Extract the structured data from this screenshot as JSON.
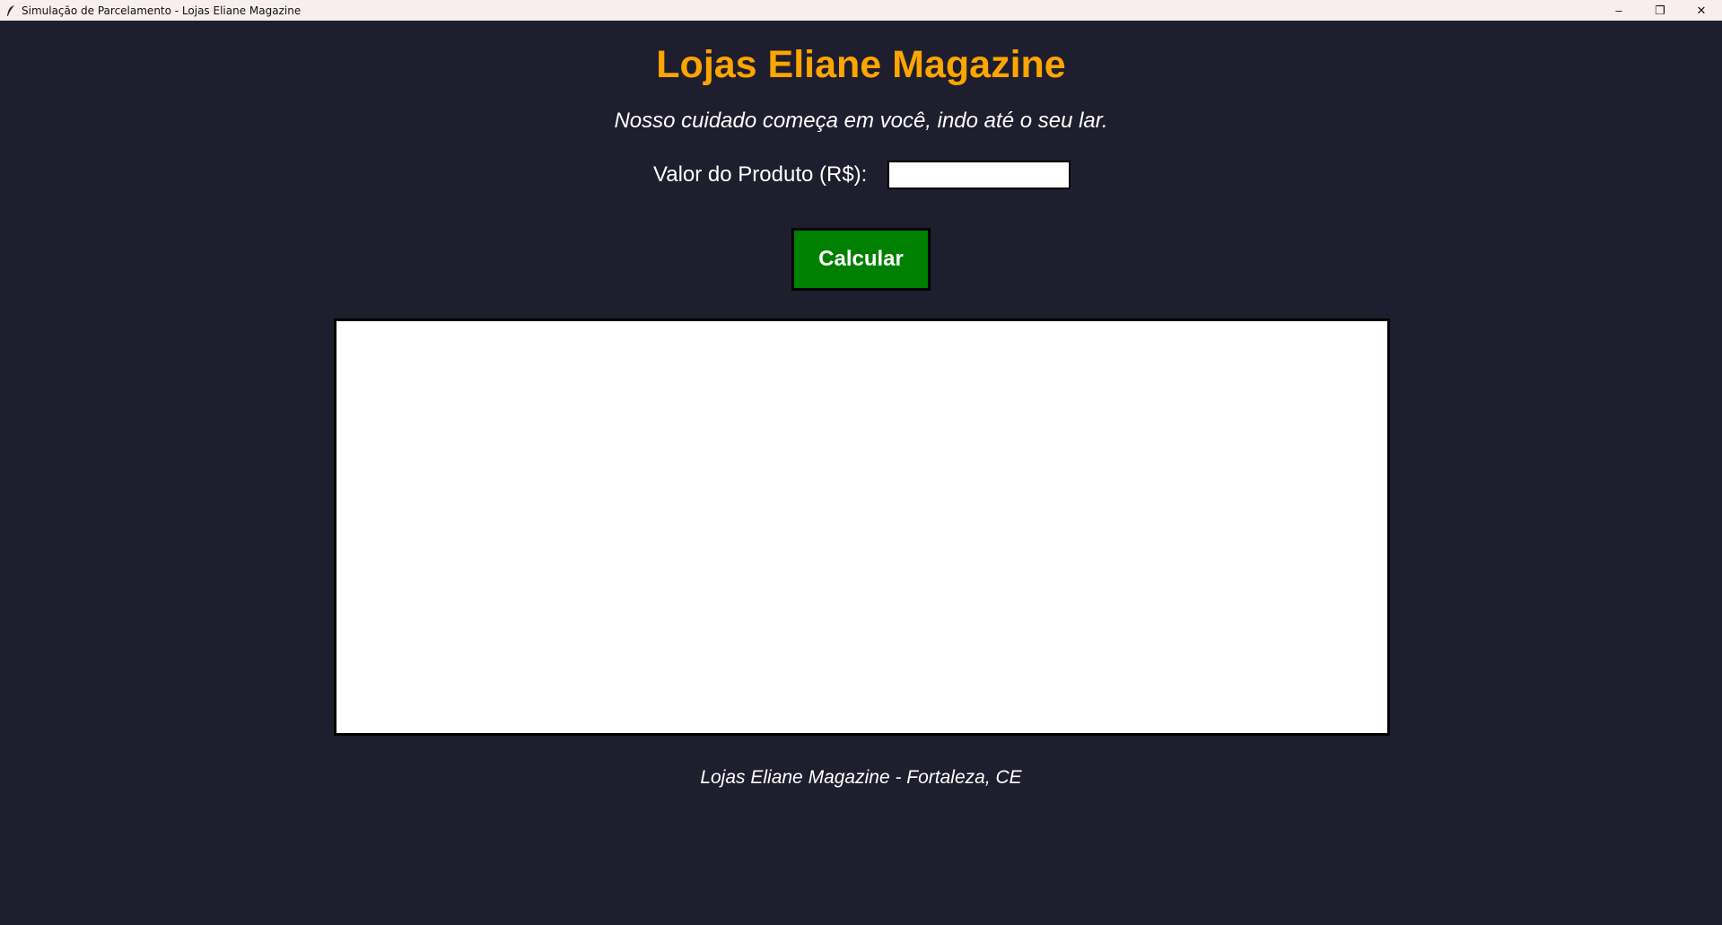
{
  "window": {
    "title": "Simulação de Parcelamento - Lojas Eliane Magazine",
    "icon": "feather-icon",
    "controls": {
      "minimize": "–",
      "restore": "❐",
      "close": "✕"
    }
  },
  "header": {
    "title": "Lojas Eliane Magazine",
    "slogan": "Nosso cuidado começa em você, indo até o seu lar."
  },
  "form": {
    "price_label": "Valor do Produto (R$):",
    "price_value": "",
    "calculate_label": "Calcular"
  },
  "results": {
    "text": ""
  },
  "footer": {
    "text": "Lojas Eliane Magazine - Fortaleza, CE"
  },
  "colors": {
    "background": "#1e1e2e",
    "title": "#ffa500",
    "button": "#008000",
    "text": "#ffffff"
  }
}
